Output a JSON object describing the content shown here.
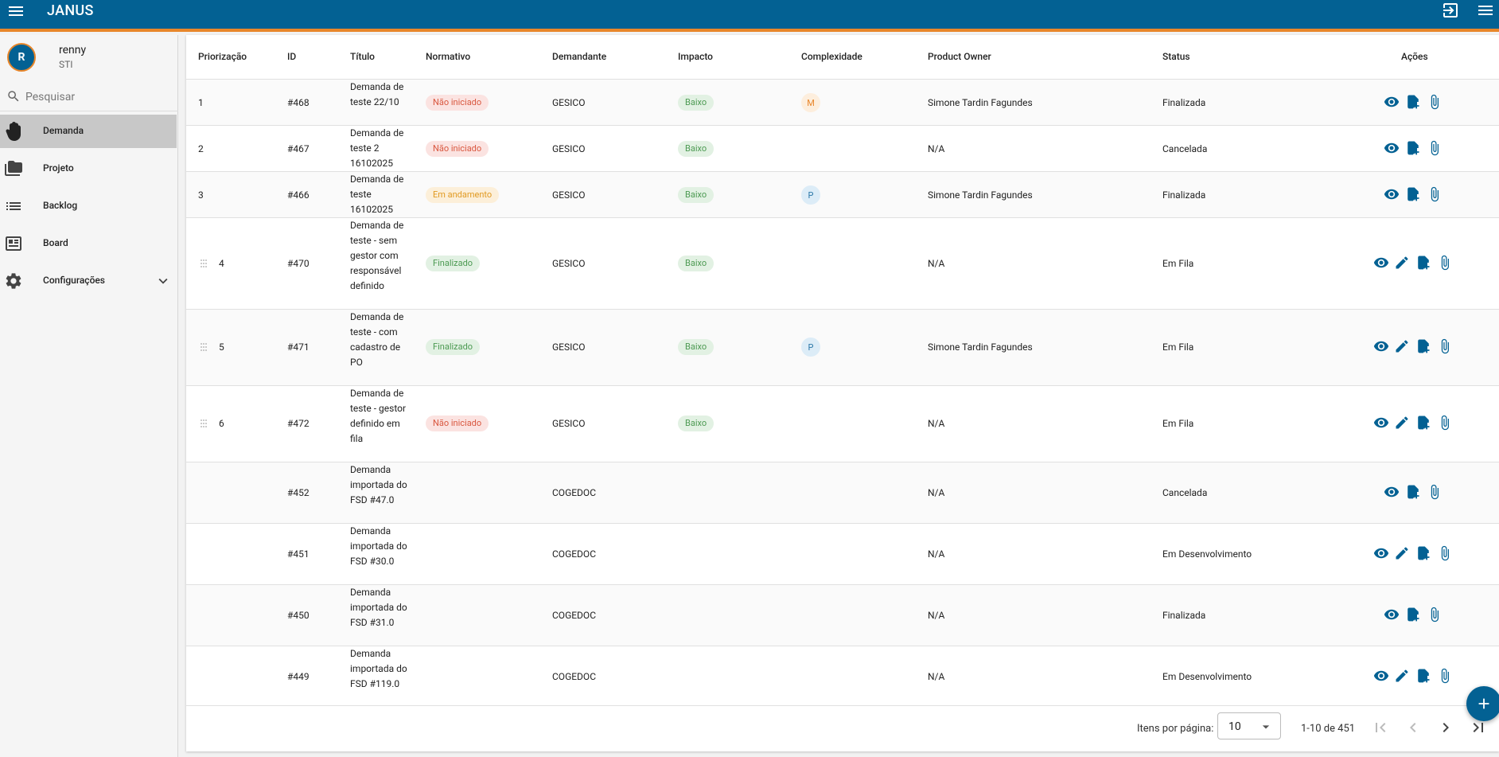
{
  "app": {
    "title": "JANUS"
  },
  "user": {
    "initial": "R",
    "name": "renny",
    "org": "STI"
  },
  "search": {
    "placeholder": "Pesquisar"
  },
  "nav": [
    {
      "label": "Demanda",
      "icon": "hand-icon",
      "active": true
    },
    {
      "label": "Projeto",
      "icon": "folder-icon"
    },
    {
      "label": "Backlog",
      "icon": "list-icon"
    },
    {
      "label": "Board",
      "icon": "board-icon"
    },
    {
      "label": "Configurações",
      "icon": "gear-icon"
    }
  ],
  "table": {
    "headers": [
      "Priorização",
      "ID",
      "Título",
      "Normativo",
      "Demandante",
      "Impacto",
      "Complexidade",
      "Product Owner",
      "Status",
      "Ações"
    ],
    "rows": [
      {
        "prio": "1",
        "id": "#468",
        "title": "Demanda de teste 22/10",
        "normativo": "Não iniciado",
        "demandante": "GESICO",
        "impacto": "Baixo",
        "complexidade": "M",
        "po": "Simone Tardin Fagundes",
        "status": "Finalizada"
      },
      {
        "prio": "2",
        "id": "#467",
        "title": "Demanda de teste 2 16102025",
        "normativo": "Não iniciado",
        "demandante": "GESICO",
        "impacto": "Baixo",
        "complexidade": "",
        "po": "N/A",
        "status": "Cancelada"
      },
      {
        "prio": "3",
        "id": "#466",
        "title": "Demanda de teste 16102025",
        "normativo": "Em andamento",
        "demandante": "GESICO",
        "impacto": "Baixo",
        "complexidade": "P",
        "po": "Simone Tardin Fagundes",
        "status": "Finalizada"
      },
      {
        "prio": "4",
        "id": "#470",
        "title": "Demanda de teste - sem gestor com responsável definido",
        "normativo": "Finalizado",
        "demandante": "GESICO",
        "impacto": "Baixo",
        "complexidade": "",
        "po": "N/A",
        "status": "Em Fila"
      },
      {
        "prio": "5",
        "id": "#471",
        "title": "Demanda de teste - com cadastro de PO",
        "normativo": "Finalizado",
        "demandante": "GESICO",
        "impacto": "Baixo",
        "complexidade": "P",
        "po": "Simone Tardin Fagundes",
        "status": "Em Fila"
      },
      {
        "prio": "6",
        "id": "#472",
        "title": "Demanda de teste - gestor definido em fila",
        "normativo": "Não iniciado",
        "demandante": "GESICO",
        "impacto": "Baixo",
        "complexidade": "",
        "po": "N/A",
        "status": "Em Fila"
      },
      {
        "prio": "",
        "id": "#452",
        "title": "Demanda importada do FSD #47.0",
        "normativo": "",
        "demandante": "COGEDOC",
        "impacto": "",
        "complexidade": "",
        "po": "N/A",
        "status": "Cancelada"
      },
      {
        "prio": "",
        "id": "#451",
        "title": "Demanda importada do FSD #30.0",
        "normativo": "",
        "demandante": "COGEDOC",
        "impacto": "",
        "complexidade": "",
        "po": "N/A",
        "status": "Em Desenvolvimento"
      },
      {
        "prio": "",
        "id": "#450",
        "title": "Demanda importada do FSD #31.0",
        "normativo": "",
        "demandante": "COGEDOC",
        "impacto": "",
        "complexidade": "",
        "po": "N/A",
        "status": "Finalizada"
      },
      {
        "prio": "",
        "id": "#449",
        "title": "Demanda importada do FSD #119.0",
        "normativo": "",
        "demandante": "COGEDOC",
        "impacto": "",
        "complexidade": "",
        "po": "N/A",
        "status": "Em Desenvolvimento"
      }
    ]
  },
  "pagination": {
    "items_per_page_label": "Itens por página:",
    "items_per_page": "10",
    "range": "1-10 de 451"
  },
  "colors": {
    "primary": "#036193",
    "accent": "#e8862a"
  }
}
